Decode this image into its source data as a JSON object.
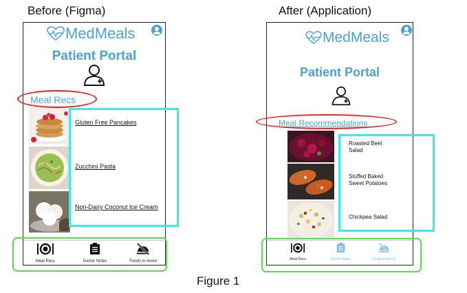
{
  "captions": {
    "before": "Before (Figma)",
    "after": "After (Application)",
    "figure": "Figure 1"
  },
  "before": {
    "logo": "MedMeals",
    "portal_title": "Patient Portal",
    "meal_heading": "Meal Recs",
    "meals": [
      {
        "name": "Gluten Free Pancakes",
        "image": "pancakes"
      },
      {
        "name": "Zucchini Pasta",
        "image": "zucchini-pasta"
      },
      {
        "name": "Non-Dairy Coconut Ice Cream",
        "image": "coconut-ice-cream"
      }
    ],
    "tabs": [
      {
        "label": "Meal Recs",
        "icon": "plate-fork-knife-icon"
      },
      {
        "label": "Doctor Notes",
        "icon": "clipboard-icon"
      },
      {
        "label": "Foods to Avoid",
        "icon": "no-food-icon"
      }
    ]
  },
  "after": {
    "logo": "MedMeals",
    "portal_title": "Patient Portal",
    "meal_heading": "Meal Recommendations",
    "meals": [
      {
        "line1": "Roasted Beet",
        "line2": "Salad",
        "image": "beet-salad"
      },
      {
        "line1": "Stuffed Baked",
        "line2": "Sweet Potatoes",
        "image": "sweet-potatoes"
      },
      {
        "line1": "Chickpea Salad",
        "line2": "",
        "image": "chickpea-salad"
      }
    ],
    "tabs": [
      {
        "label": "Meal Recs",
        "icon": "plate-fork-knife-icon"
      },
      {
        "label": "Doctor Notes",
        "icon": "clipboard-icon"
      },
      {
        "label": "Foods to Avoid",
        "icon": "no-food-icon"
      }
    ]
  },
  "colors": {
    "brand": "#4aa3d8",
    "highlight_cyan": "#3ee8ef",
    "highlight_green": "#52e34a",
    "highlight_red": "#e22222"
  }
}
